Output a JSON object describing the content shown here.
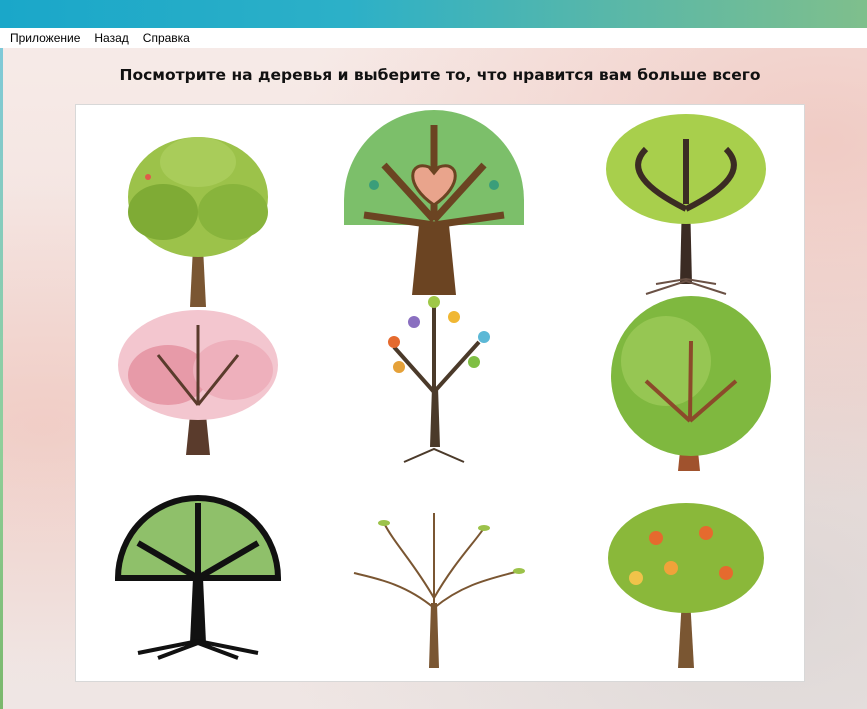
{
  "menu": {
    "items": [
      {
        "label": "Приложение"
      },
      {
        "label": "Назад"
      },
      {
        "label": "Справка"
      }
    ]
  },
  "heading": "Посмотрите на деревья и выберите то, что нравится вам больше всего",
  "trees": [
    {
      "name": "green-leafy-tree-image"
    },
    {
      "name": "heart-tree-image"
    },
    {
      "name": "swirl-tree-image"
    },
    {
      "name": "cherry-blossom-tree-image"
    },
    {
      "name": "colorful-leaves-tree-image"
    },
    {
      "name": "round-green-tree-image"
    },
    {
      "name": "stained-glass-tree-image"
    },
    {
      "name": "bare-sprout-tree-image"
    },
    {
      "name": "fruit-tree-image"
    }
  ],
  "colors": {
    "accent_strip": "#1aa7c9",
    "leaf_green": "#8ab83a",
    "trunk_brown": "#6b4a2b",
    "blossom_pink": "#e79aa8",
    "fruit_orange": "#e56a2e"
  }
}
